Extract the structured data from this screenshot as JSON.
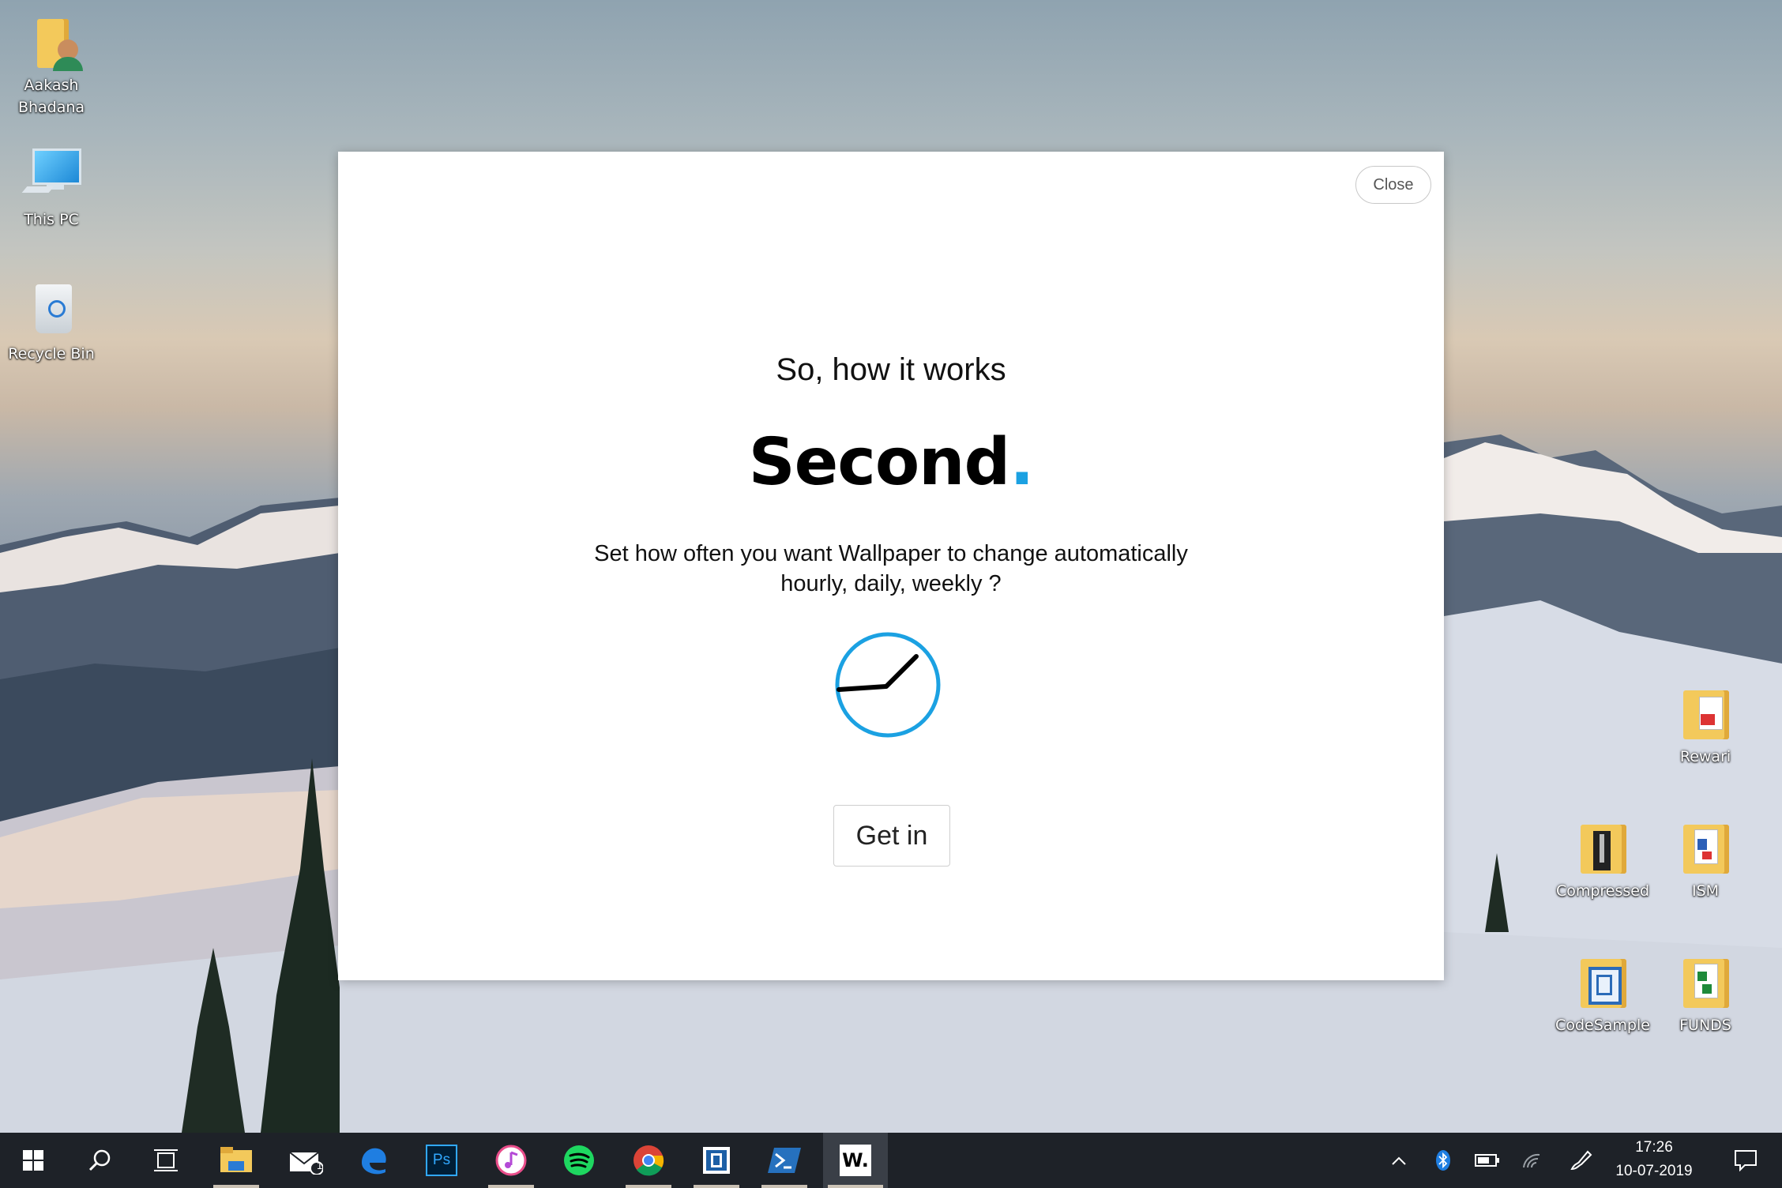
{
  "desktop": {
    "icons": [
      {
        "label": "Aakash\nBhadana",
        "icon": "user-folder-icon"
      },
      {
        "label": "This PC",
        "icon": "computer-icon"
      },
      {
        "label": "Recycle Bin",
        "icon": "recycle-bin-icon"
      },
      {
        "label": "Rewari",
        "icon": "pdf-folder-icon"
      },
      {
        "label": "Compressed",
        "icon": "zip-folder-icon"
      },
      {
        "label": "ISM",
        "icon": "document-folder-icon"
      },
      {
        "label": "CodeSample",
        "icon": "code-folder-icon"
      },
      {
        "label": "FUNDS",
        "icon": "spreadsheet-folder-icon"
      }
    ]
  },
  "dialog": {
    "close_label": "Close",
    "intro": "So, how it works",
    "heading": "Second",
    "heading_dot": ".",
    "description_line1": "Set how often you want Wallpaper to change automatically",
    "description_line2": "hourly, daily, weekly ?",
    "cta_label": "Get in",
    "accent_color": "#1ba1e2"
  },
  "taskbar": {
    "items": [
      "start-icon",
      "search-icon",
      "task-view-icon",
      "file-explorer-icon",
      "mail-icon",
      "edge-icon",
      "photoshop-icon",
      "itunes-icon",
      "spotify-icon",
      "chrome-icon",
      "remote-desktop-icon",
      "powershell-icon",
      "wallpaper-app-icon"
    ],
    "mail_badge": "1",
    "photoshop_label": "Ps",
    "wallpaper_label": "W.",
    "tray": {
      "time": "17:26",
      "date": "10-07-2019"
    }
  }
}
